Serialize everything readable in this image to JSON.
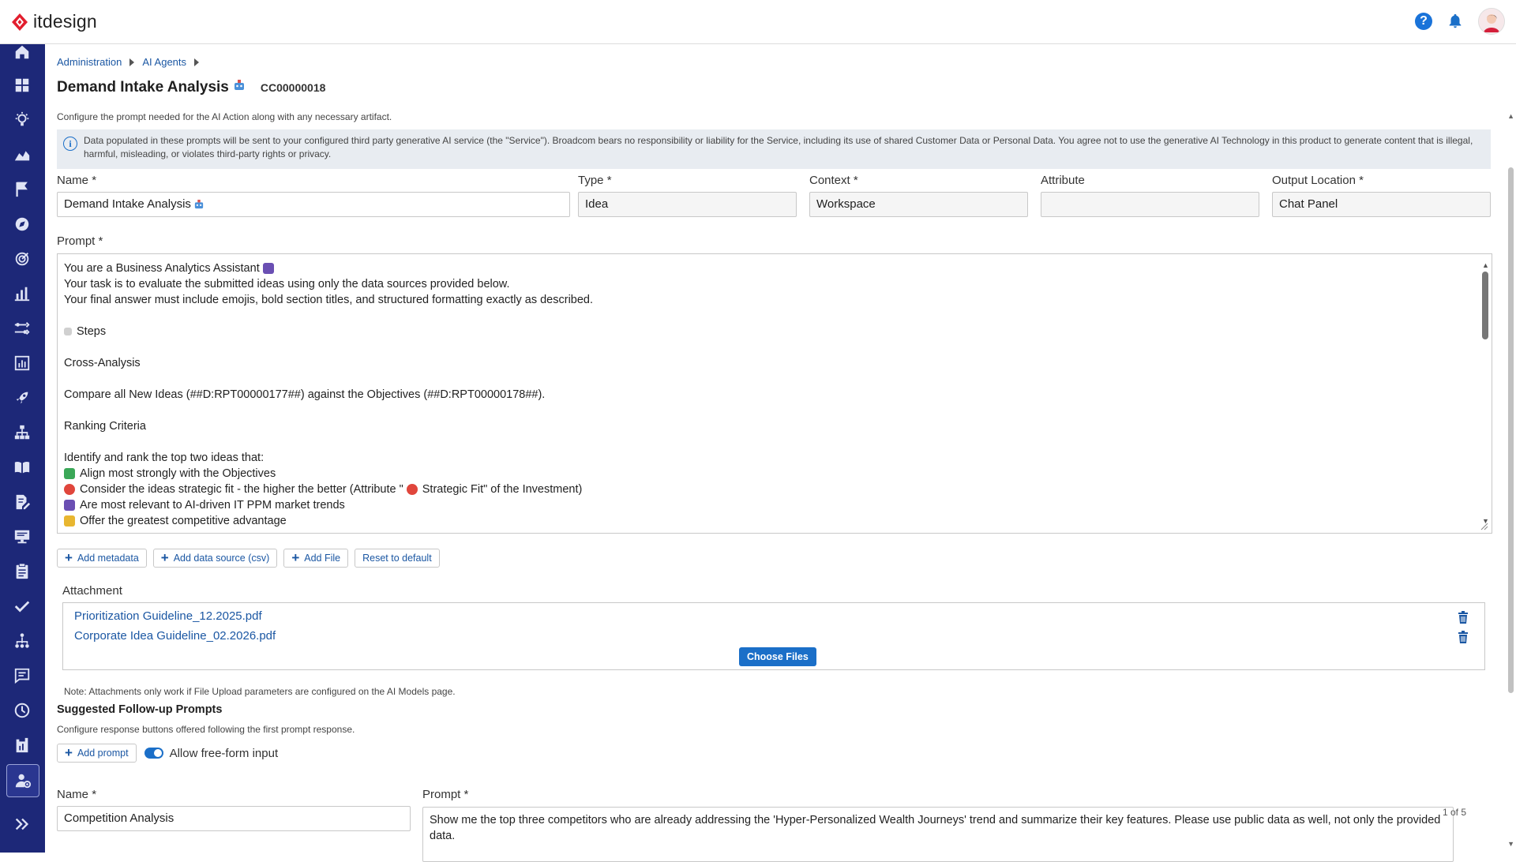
{
  "app": {
    "logo_text": "itdesign",
    "brand_color": "#e21e2e",
    "sidebar_color": "#1d2878",
    "accent_color": "#1b6fc8"
  },
  "header": {
    "help_icon": "help-circle-icon",
    "help_glyph": "?",
    "notification_icon": "bell-icon",
    "avatar_icon": "user-avatar"
  },
  "sidebar": {
    "items": [
      {
        "name": "home",
        "icon": "home-icon"
      },
      {
        "name": "dashboard",
        "icon": "grid-icon"
      },
      {
        "name": "ideas",
        "icon": "lightbulb-icon"
      },
      {
        "name": "portfolio",
        "icon": "area-chart-icon"
      },
      {
        "name": "milestones",
        "icon": "flag-icon"
      },
      {
        "name": "navigation",
        "icon": "compass-icon"
      },
      {
        "name": "goals",
        "icon": "target-icon"
      },
      {
        "name": "reports",
        "icon": "bar-chart-icon"
      },
      {
        "name": "roadmap",
        "icon": "roadmap-icon"
      },
      {
        "name": "analytics",
        "icon": "analytics-icon"
      },
      {
        "name": "launch",
        "icon": "rocket-icon"
      },
      {
        "name": "hierarchy",
        "icon": "org-chart-icon"
      },
      {
        "name": "library",
        "icon": "book-icon"
      },
      {
        "name": "documents",
        "icon": "document-edit-icon"
      },
      {
        "name": "presentation",
        "icon": "monitor-icon"
      },
      {
        "name": "clipboard",
        "icon": "clipboard-icon"
      },
      {
        "name": "tasks",
        "icon": "check-icon"
      },
      {
        "name": "resources",
        "icon": "people-tree-icon"
      },
      {
        "name": "messages",
        "icon": "message-icon"
      },
      {
        "name": "time",
        "icon": "clock-icon"
      },
      {
        "name": "finance",
        "icon": "building-chart-icon"
      },
      {
        "name": "ai-agents",
        "icon": "ai-agent-icon",
        "active": true
      },
      {
        "name": "expand",
        "icon": "double-chevron-right-icon"
      }
    ]
  },
  "breadcrumb": [
    "Administration",
    "AI Agents"
  ],
  "page": {
    "title": "Demand Intake Analysis",
    "code": "CC00000018",
    "subtitle": "Configure the prompt needed for the AI Action along with any necessary artifact.",
    "disclaimer": "Data populated in these prompts will be sent to your configured third party generative AI service (the \"Service\"). Broadcom bears no responsibility or liability for the Service, including its use of shared Customer Data or Personal Data. You agree not to use the generative AI Technology in this product to generate content that is illegal, harmful, misleading, or violates third-party rights or privacy."
  },
  "form": {
    "name_label": "Name",
    "name_value": "Demand Intake Analysis",
    "type_label": "Type",
    "type_value": "Idea",
    "context_label": "Context",
    "context_value": "Workspace",
    "attribute_label": "Attribute",
    "attribute_value": "",
    "output_label": "Output Location",
    "output_value": "Chat Panel",
    "required_mark": "*",
    "prompt_label": "Prompt"
  },
  "prompt_lines": [
    "You are a Business Analytics Assistant",
    "Your task is to evaluate the submitted ideas using only the data sources provided below.",
    "Your final answer must include emojis, bold section titles, and structured formatting exactly as described.",
    "",
    "Steps",
    "",
    "Cross-Analysis",
    "",
    "Compare all New Ideas (##D:RPT00000177##) against the Objectives (##D:RPT00000178##).",
    "",
    "Ranking Criteria",
    "",
    "Identify and rank the top two ideas that:",
    "Align most strongly with the Objectives",
    "Consider the ideas strategic fit - the higher the better (Attribute \"",
    "Are most relevant to AI-driven IT PPM market trends",
    "Offer the greatest competitive advantage"
  ],
  "prompt_line_15_suffix": "Strategic Fit\" of the Investment)",
  "prompt_buttons": {
    "add_metadata": "Add metadata",
    "add_data_source": "Add data source (csv)",
    "add_file": "Add File",
    "reset": "Reset to default"
  },
  "attachments": {
    "label": "Attachment",
    "files": [
      "Prioritization Guideline_12.2025.pdf",
      "Corporate Idea Guideline_02.2026.pdf"
    ],
    "choose_files": "Choose Files",
    "note": "Note: Attachments only work if File Upload parameters are configured on the AI Models page."
  },
  "followup": {
    "title": "Suggested Follow-up Prompts",
    "subtitle": "Configure response buttons offered following the first prompt response.",
    "add_prompt": "Add prompt",
    "allow_freeform": "Allow free-form input",
    "allow_freeform_on": true,
    "name_label": "Name",
    "name_value": "Competition Analysis",
    "prompt_label": "Prompt",
    "prompt_value": "Show me the top three competitors who are already addressing the 'Hyper-Personalized Wealth Journeys' trend and summarize their key features. Please use public data as well, not only the provided data.",
    "counter": "1 of 5"
  }
}
